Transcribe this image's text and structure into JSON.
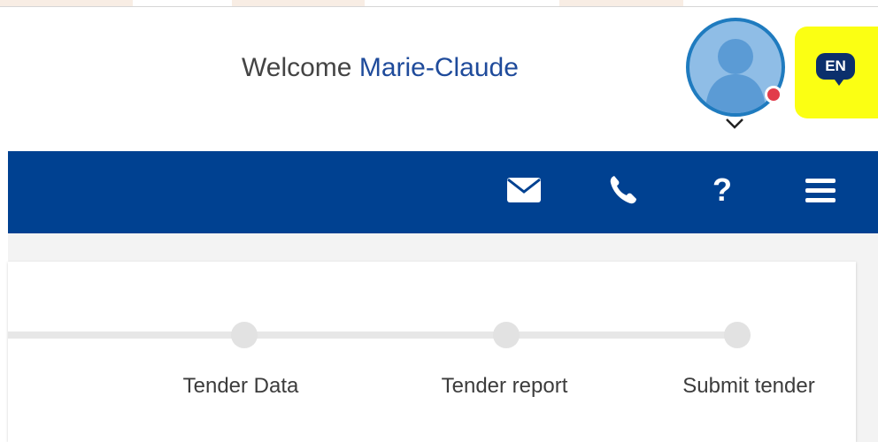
{
  "header": {
    "welcome_prefix": "Welcome",
    "user_name": "Marie-Claude",
    "avatar_icon": "user-avatar-icon",
    "status_color": "#e23b4a",
    "language": "EN"
  },
  "nav": {
    "bg_color": "#004191",
    "icons": [
      "mail-icon",
      "phone-icon",
      "help-icon",
      "menu-icon"
    ],
    "help_label": "?"
  },
  "stepper": {
    "steps": [
      {
        "label": "Tender Data"
      },
      {
        "label": "Tender report"
      },
      {
        "label": "Submit tender"
      }
    ]
  },
  "colors": {
    "accent": "#1f4b9b",
    "highlight": "#fbff13",
    "language_badge": "#0b2f6c"
  }
}
